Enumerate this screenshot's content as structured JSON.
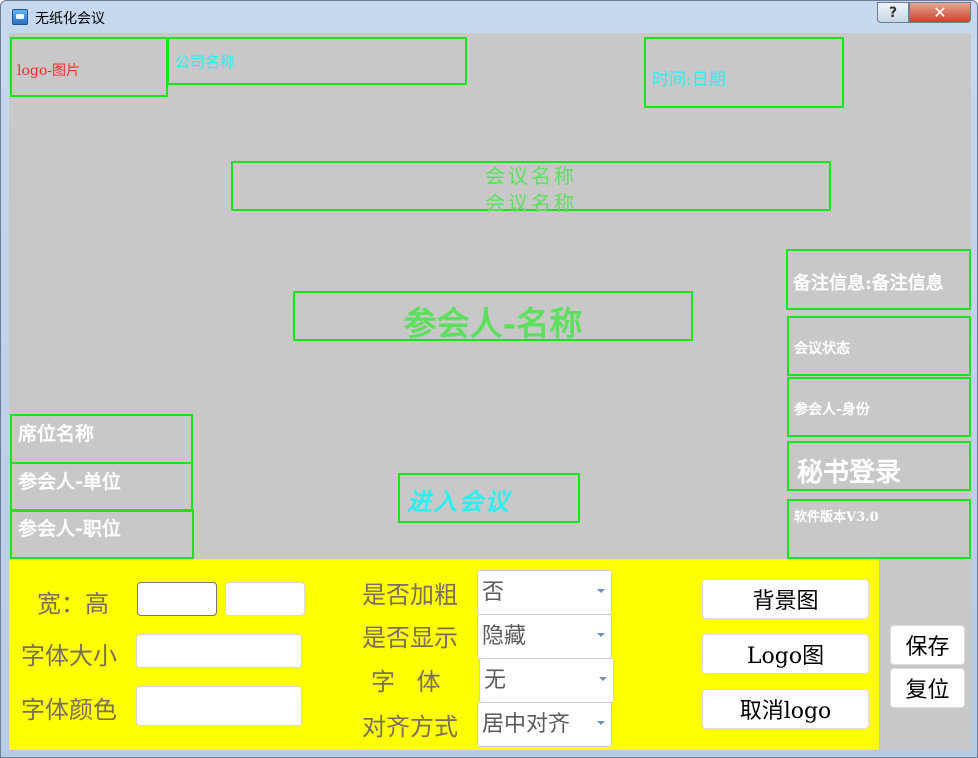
{
  "window": {
    "title": "无纸化会议",
    "help_label": "?",
    "close_label": "✕"
  },
  "layout_boxes": {
    "logo": "logo-图片",
    "company": "公司名称",
    "time": "时间:日期",
    "meeting_name_line1": "会议名称",
    "meeting_name_line2": "会议名称",
    "remark": "备注信息:备注信息",
    "participant_name": "参会人-名称",
    "meeting_status": "会议状态",
    "participant_identity": "参会人-身份",
    "seat_name": "席位名称",
    "participant_unit": "参会人-单位",
    "participant_position": "参会人-职位",
    "enter_meeting": "进入会议",
    "secretary_login": "秘书登录",
    "software_version": "软件版本V3.0"
  },
  "colors": {
    "box_border": "#18e418",
    "client_bg": "#c8c8c8",
    "panel_bg": "#ffff00",
    "logo_text": "#ff2a2a",
    "cyan_text": "#28f0f0",
    "green_text": "#5ce05c"
  },
  "editor": {
    "width_height_label": "宽：高",
    "font_size_label": "字体大小",
    "font_color_label": "字体颜色",
    "width_value": "",
    "height_value": "",
    "font_size_value": "",
    "font_color_value": "",
    "bold_label": "是否加粗",
    "bold_value": "否",
    "show_label": "是否显示",
    "show_value": "隐藏",
    "font_label": "字 体",
    "font_value": "无",
    "align_label": "对齐方式",
    "align_value": "居中对齐",
    "background_btn": "背景图",
    "logo_btn": "Logo图",
    "cancel_logo_btn": "取消logo",
    "save_btn": "保存",
    "reset_btn": "复位"
  }
}
